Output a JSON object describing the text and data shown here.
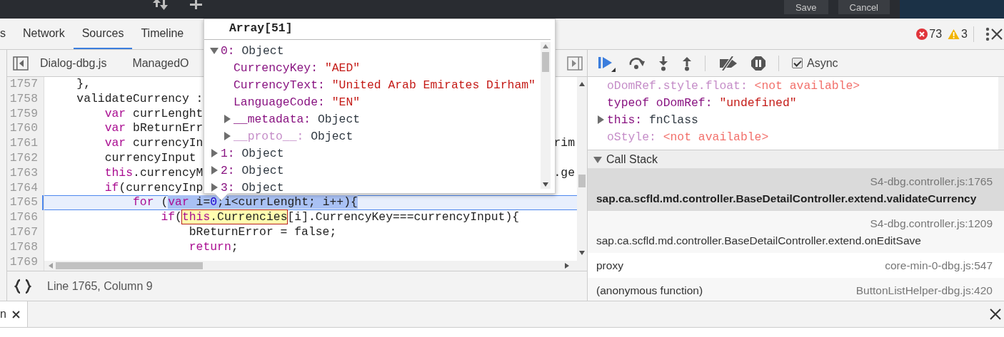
{
  "top_bar": {
    "buttons": [
      {
        "label": "Save"
      },
      {
        "label": "Cancel"
      }
    ]
  },
  "panel_tabs": [
    {
      "label": "s",
      "selected": false
    },
    {
      "label": "Network",
      "selected": false
    },
    {
      "label": "Sources",
      "selected": true
    },
    {
      "label": "Timeline",
      "selected": false
    }
  ],
  "counters": {
    "errors": "73",
    "warnings": "3"
  },
  "file_tabs": [
    {
      "label": "Dialog-dbg.js"
    },
    {
      "label": "ManagedO"
    }
  ],
  "code": {
    "lines": [
      {
        "number": "1757",
        "current": false,
        "tokens": [
          {
            "kind": "plain",
            "text": "    },"
          }
        ]
      },
      {
        "number": "1758",
        "current": false,
        "tokens": [
          {
            "kind": "plain",
            "text": "    validateCurrency :"
          }
        ]
      },
      {
        "number": "1759",
        "current": false,
        "tokens": [
          {
            "kind": "keyword",
            "text": "        var"
          },
          {
            "kind": "plain",
            "text": " currLenght"
          }
        ]
      },
      {
        "number": "1760",
        "current": false,
        "tokens": [
          {
            "kind": "keyword",
            "text": "        var"
          },
          {
            "kind": "plain",
            "text": " bReturnErr"
          }
        ]
      },
      {
        "number": "1761",
        "current": false,
        "tokens": [
          {
            "kind": "keyword",
            "text": "        var"
          },
          {
            "kind": "plain",
            "text": " currencyIn"
          }
        ],
        "tail": "rim"
      },
      {
        "number": "1762",
        "current": false,
        "tokens": [
          {
            "kind": "plain",
            "text": "        currencyInput"
          }
        ]
      },
      {
        "number": "1763",
        "current": false,
        "tokens": [
          {
            "kind": "keyword",
            "text": "        this"
          },
          {
            "kind": "plain",
            "text": ".currencyM"
          }
        ],
        "tail": ".ge"
      },
      {
        "number": "1764",
        "current": false,
        "tokens": [
          {
            "kind": "keyword",
            "text": "        if"
          },
          {
            "kind": "plain",
            "text": "(currencyInp"
          }
        ]
      },
      {
        "number": "1765",
        "current": true,
        "tokens": [
          {
            "kind": "keyword",
            "text": "            for"
          },
          {
            "kind": "plain",
            "text": " ("
          },
          {
            "kind": "selection",
            "tokens": [
              {
                "kind": "keyword",
                "text": "var"
              },
              {
                "kind": "plain",
                "text": " i="
              },
              {
                "kind": "number",
                "text": "0"
              },
              {
                "kind": "plain",
                "text": ";i<currLenght; i++){"
              }
            ]
          }
        ]
      },
      {
        "number": "1766",
        "current": false,
        "tokens": [
          {
            "kind": "keyword",
            "text": "                if"
          },
          {
            "kind": "plain",
            "text": "("
          },
          {
            "kind": "hover",
            "tokens": [
              {
                "kind": "keyword",
                "text": "this"
              },
              {
                "kind": "plain",
                "text": ".Currencies"
              }
            ]
          },
          {
            "kind": "plain",
            "text": "[i].CurrencyKey===currencyInput){"
          }
        ]
      },
      {
        "number": "1767",
        "current": false,
        "tokens": [
          {
            "kind": "plain",
            "text": "                    bReturnError = false;"
          }
        ]
      },
      {
        "number": "1768",
        "current": false,
        "tokens": [
          {
            "kind": "keyword",
            "text": "                    return"
          },
          {
            "kind": "plain",
            "text": ";"
          }
        ]
      },
      {
        "number": "1769",
        "current": false
      }
    ]
  },
  "status": {
    "position": "Line 1765, Column 9"
  },
  "popover": {
    "title": "Array[51]",
    "items": [
      {
        "key": "0:",
        "value": "Object",
        "kind": "object",
        "expanded": true,
        "children": [
          {
            "key": "CurrencyKey:",
            "value": "\"AED\"",
            "kind": "string"
          },
          {
            "key": "CurrencyText:",
            "value": "\"United Arab Emirates Dirham\"",
            "kind": "string"
          },
          {
            "key": "LanguageCode:",
            "value": "\"EN\"",
            "kind": "string"
          },
          {
            "key": "__metadata:",
            "value": "Object",
            "kind": "object",
            "expanded": false
          },
          {
            "key": "__proto__:",
            "value": "Object",
            "kind": "inherited",
            "expanded": false
          }
        ]
      },
      {
        "key": "1:",
        "value": "Object",
        "kind": "object",
        "expanded": false
      },
      {
        "key": "2:",
        "value": "Object",
        "kind": "object",
        "expanded": false
      },
      {
        "key": "3:",
        "value": "Object",
        "kind": "object",
        "expanded": false
      }
    ]
  },
  "debugger_toolbar": {
    "async": {
      "label": "Async",
      "checked": true
    }
  },
  "scope": {
    "items": [
      {
        "key": "oDomRef.style.float:",
        "value": "<not available>",
        "kind": "unavailable"
      },
      {
        "key": "typeof oDomRef:",
        "value": "\"undefined\"",
        "kind": "string"
      },
      {
        "key": "this:",
        "value": "fnClass",
        "kind": "object",
        "expanded": false
      },
      {
        "key": "oStyle:",
        "value": "<not available>",
        "kind": "unavailable"
      }
    ]
  },
  "call_stack": {
    "title": "Call Stack",
    "expanded": true,
    "frames": [
      {
        "name": "sap.ca.scfld.md.controller.BaseDetailController.extend.validateCurrency",
        "location": "S4-dbg.controller.js:1765",
        "selected": true
      },
      {
        "name": "sap.ca.scfld.md.controller.BaseDetailController.extend.onEditSave",
        "location": "S4-dbg.controller.js:1209",
        "selected": false
      },
      {
        "name": "proxy",
        "location": "core-min-0-dbg.js:547",
        "selected": false
      },
      {
        "name": "(anonymous function)",
        "location": "ButtonListHelper-dbg.js:420",
        "selected": false
      }
    ]
  },
  "drawer": {
    "tab": "n"
  }
}
